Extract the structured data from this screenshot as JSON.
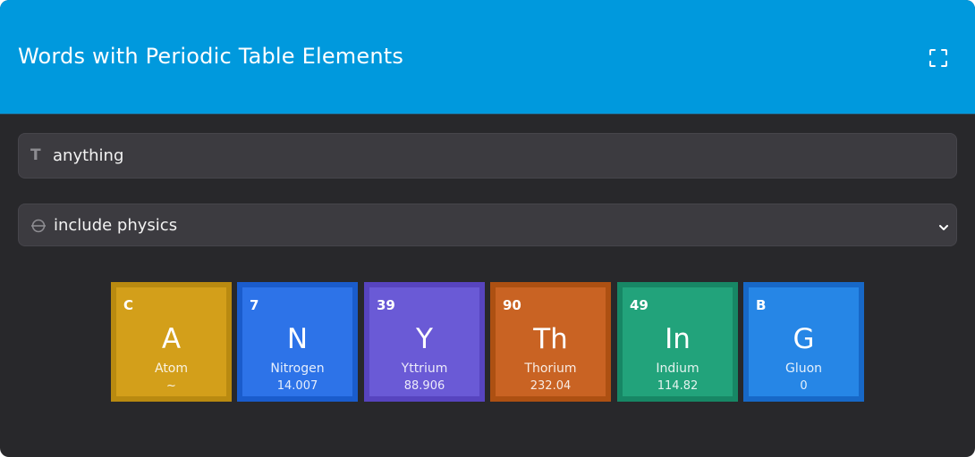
{
  "header": {
    "title": "Words with Periodic Table Elements",
    "bg_color": "#0099dd"
  },
  "icons": {
    "fullscreen": "fullscreen-icon",
    "text_input": "text-type-icon",
    "select": "theta-circle-icon",
    "chevron": "chevron-down-icon"
  },
  "word_input": {
    "value": "anything",
    "icon_glyph": "T"
  },
  "mode_select": {
    "value": "include physics"
  },
  "tiles": [
    {
      "number": "C",
      "symbol": "A",
      "name": "Atom",
      "mass": "~",
      "fill": "#d39f1a",
      "border": "#b98a10"
    },
    {
      "number": "7",
      "symbol": "N",
      "name": "Nitrogen",
      "mass": "14.007",
      "fill": "#2d73e8",
      "border": "#1a5ccc"
    },
    {
      "number": "39",
      "symbol": "Y",
      "name": "Yttrium",
      "mass": "88.906",
      "fill": "#6a5ad6",
      "border": "#5744bf"
    },
    {
      "number": "90",
      "symbol": "Th",
      "name": "Thorium",
      "mass": "232.04",
      "fill": "#c96323",
      "border": "#ad5012"
    },
    {
      "number": "49",
      "symbol": "In",
      "name": "Indium",
      "mass": "114.82",
      "fill": "#22a37b",
      "border": "#178765"
    },
    {
      "number": "B",
      "symbol": "G",
      "name": "Gluon",
      "mass": "0",
      "fill": "#2686e6",
      "border": "#1768c7"
    }
  ]
}
